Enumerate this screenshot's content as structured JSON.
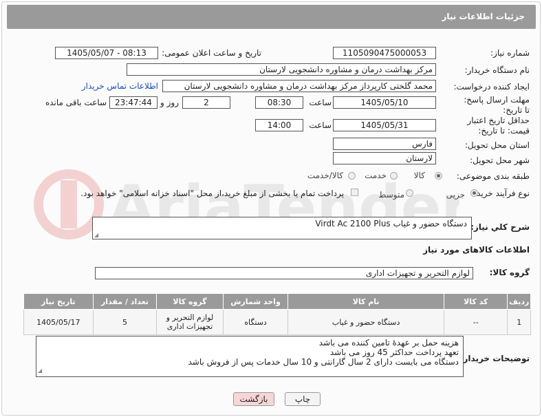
{
  "header": {
    "title": "جزئیات اطلاعات نیاز"
  },
  "fields": {
    "need_number_label": "شماره نیاز:",
    "need_number": "1105090475000053",
    "announce_label": "تاریخ و ساعت اعلان عمومی:",
    "announce_value": "1405/05/07 - 08:13",
    "buyer_org_label": "نام دستگاه خریدار:",
    "buyer_org": "مرکز بهداشت  درمان و مشاوره دانشجویی لارستان",
    "requester_label": "ایجاد کننده درخواست:",
    "requester": "محمد گلختی کارپرداز مرکز بهداشت  درمان و مشاوره دانشجویی لارستان",
    "buyer_contact_link": "اطلاعات تماس خریدار",
    "deadline_label": "مهلت ارسال پاسخ: تا تاریخ:",
    "deadline_date": "1405/05/10",
    "time_label": "ساعت",
    "deadline_time": "08:30",
    "days_value": "2",
    "days_label": "روز و",
    "remaining_time": "23:47:44",
    "remaining_label": "ساعت باقی مانده",
    "price_validity_label": "حداقل تاریخ اعتبار قیمت: تا تاریخ:",
    "price_date": "1405/05/31",
    "price_time": "14:00",
    "province_label": "استان محل تحویل:",
    "province": "فارس",
    "city_label": "شهر محل تحویل:",
    "city": "لارستان",
    "category_label": "طبقه بندی موضوعی:",
    "category_options": [
      "کالا",
      "خدمت",
      "کالا/خدمت"
    ],
    "process_label": "نوع فرآیند خرید :",
    "process_options": [
      "جزیی",
      "متوسط"
    ],
    "payment_note": "پرداخت تمام یا بخشی از مبلغ خرید،از محل \"اسناد خزانه اسلامی\" خواهد بود."
  },
  "description": {
    "label": "شرح کلي نياز:",
    "value": "دستگاه حضور و غیاب Virdt Ac 2100 Plus"
  },
  "goods_info_title": "اطلاعات کالاهای مورد نیاز",
  "goods_group": {
    "label": "گروه کالا:",
    "value": "لوازم التحریر و تجهیزات اداری"
  },
  "table": {
    "headers": [
      "ردیف",
      "کد کالا",
      "نام کالا",
      "واحد شمارش",
      "گروه کالا",
      "تعداد / مقدار",
      "تاریخ نیاز"
    ],
    "rows": [
      [
        "1",
        "--",
        "دستگاه حضور و غیاب",
        "دستگاه",
        "لوازم التحریر و تجهیزات اداری",
        "5",
        "1405/05/17"
      ]
    ]
  },
  "buyer_notes": {
    "label": "توضیحات خریدار:",
    "lines": [
      "هزینه حمل بر عهدهٔ تامین کننده می باشد",
      "تعهد پرداخت حداکثر 45 روز می باشد",
      "دستگاه می بایست دارای 2 سال گارانتی و 10 سال خدمات پس از فروش باشد"
    ]
  },
  "buttons": {
    "print": "چاپ",
    "back": "بازگشت"
  },
  "colors": {
    "header_bg": "#9a9a9a",
    "link": "#1a4fb5",
    "back_btn_bg": "#f6d6d6"
  }
}
